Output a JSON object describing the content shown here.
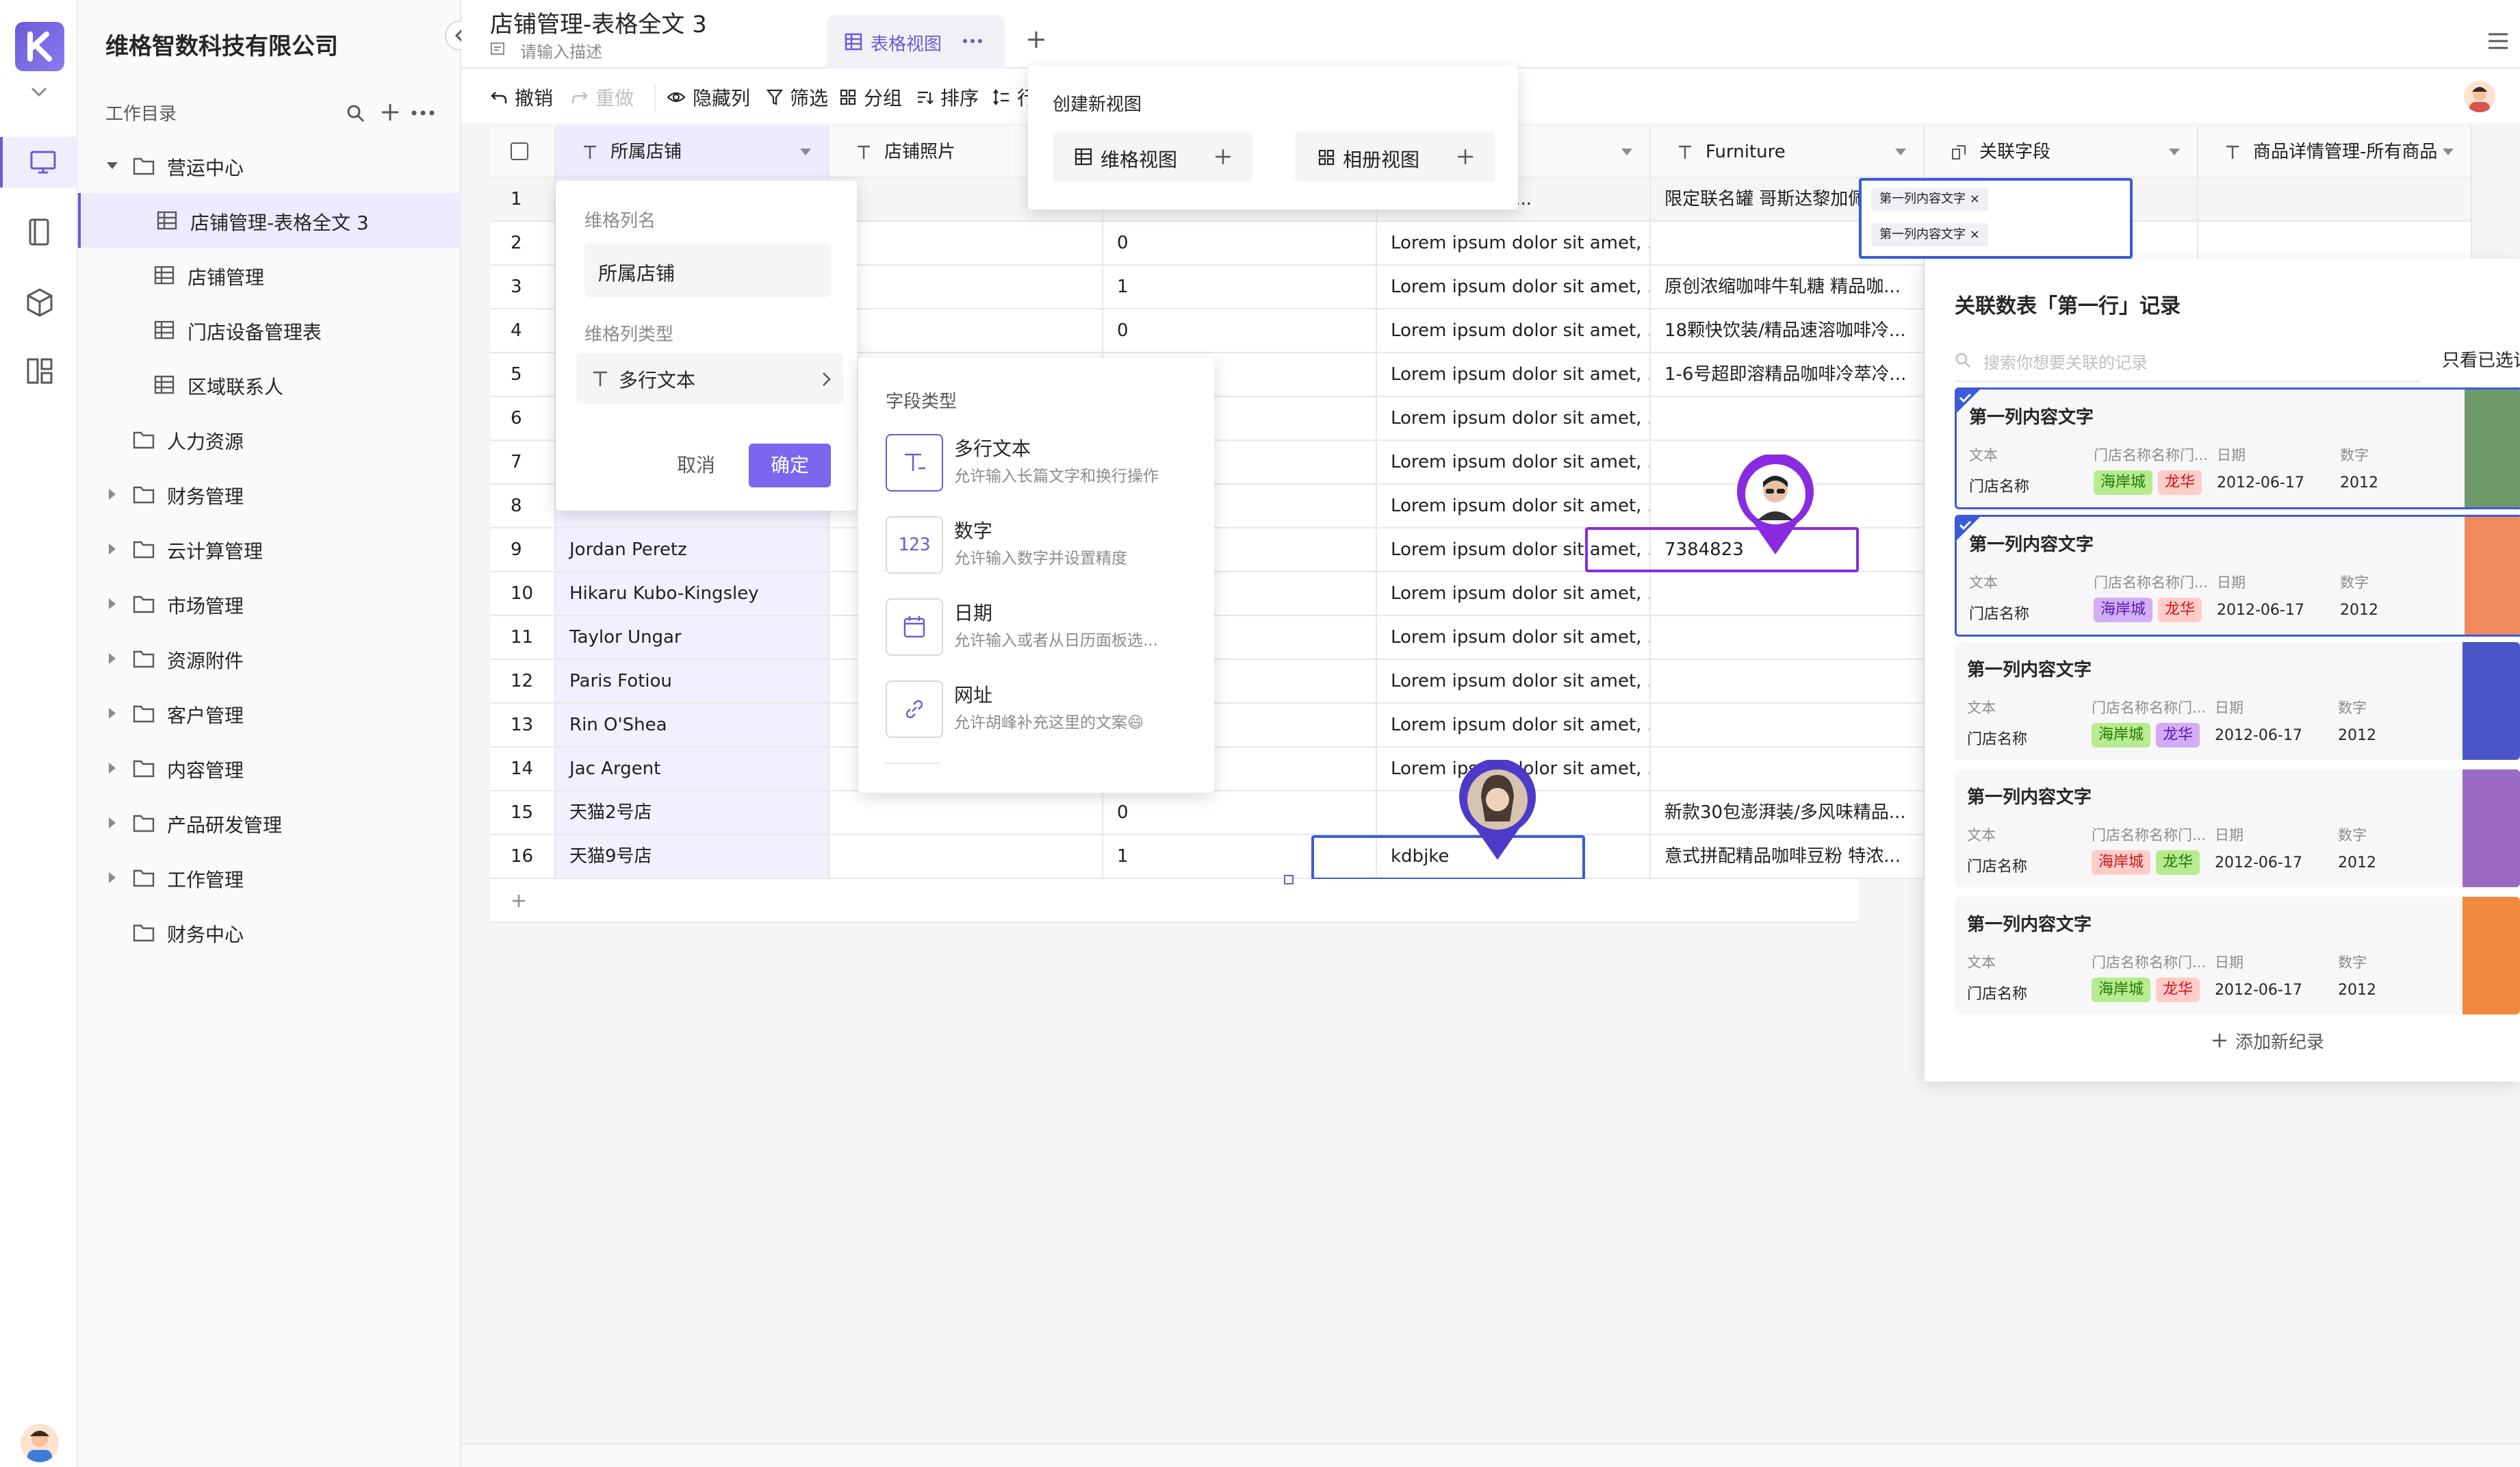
{
  "workspace": {
    "name": "维格智数科技有限公司",
    "catalog_label": "工作目录"
  },
  "tree": [
    {
      "label": "营运中心",
      "kind": "folder",
      "expanded": true,
      "level": 0
    },
    {
      "label": "店铺管理-表格全文 3",
      "kind": "sheet",
      "level": 1,
      "active": true
    },
    {
      "label": "店铺管理",
      "kind": "sheet",
      "level": 1
    },
    {
      "label": "门店设备管理表",
      "kind": "sheet",
      "level": 1
    },
    {
      "label": "区域联系人",
      "kind": "sheet",
      "level": 1
    },
    {
      "label": "人力资源",
      "kind": "folder",
      "level": 0,
      "no_arrow": true
    },
    {
      "label": "财务管理",
      "kind": "folder",
      "level": 0
    },
    {
      "label": "云计算管理",
      "kind": "folder",
      "level": 0
    },
    {
      "label": "市场管理",
      "kind": "folder",
      "level": 0
    },
    {
      "label": "资源附件",
      "kind": "folder",
      "level": 0
    },
    {
      "label": "客户管理",
      "kind": "folder",
      "level": 0
    },
    {
      "label": "内容管理",
      "kind": "folder",
      "level": 0
    },
    {
      "label": "产品研发管理",
      "kind": "folder",
      "level": 0
    },
    {
      "label": "工作管理",
      "kind": "folder",
      "level": 0
    },
    {
      "label": "财务中心",
      "kind": "folder",
      "level": 0,
      "no_arrow": true
    }
  ],
  "sheet": {
    "title": "店铺管理-表格全文 3",
    "desc_placeholder": "请输入描述",
    "tab_label": "表格视图"
  },
  "toolbar": {
    "undo": "撤销",
    "redo": "重做",
    "hide_cols": "隐藏列",
    "filter": "筛选",
    "group": "分组",
    "sort": "排序",
    "more": "行"
  },
  "create_view": {
    "title": "创建新视图",
    "grid_view": "维格视图",
    "gallery_view": "相册视图"
  },
  "columns": [
    "所属店铺",
    "店铺照片",
    "",
    "",
    "Furniture",
    "关联字段",
    "商品详情管理-所有商品"
  ],
  "rows": [
    {
      "n": "1",
      "store": "",
      "num": "",
      "text": "olor sit amet, ...",
      "furniture": "限定联名罐 哥斯达黎加佩拉..."
    },
    {
      "n": "2",
      "store": "",
      "num": "0",
      "text": "Lorem ipsum dolor sit amet, ...",
      "furniture": ""
    },
    {
      "n": "3",
      "store": "",
      "num": "1",
      "text": "Lorem ipsum dolor sit amet, ...",
      "furniture": "原创浓缩咖啡牛轧糖 精品咖..."
    },
    {
      "n": "4",
      "store": "",
      "num": "0",
      "text": "Lorem ipsum dolor sit amet, ...",
      "furniture": "18颗快饮装/精品速溶咖啡冷..."
    },
    {
      "n": "5",
      "store": "",
      "num": "",
      "text": "Lorem ipsum dolor sit amet, ...",
      "furniture": "1-6号超即溶精品咖啡冷萃冷..."
    },
    {
      "n": "6",
      "store": "",
      "num": "",
      "text": "Lorem ipsum dolor sit amet, ...",
      "furniture": ""
    },
    {
      "n": "7",
      "store": "",
      "num": "",
      "text": "Lorem ipsum dolor sit amet, ...",
      "furniture": ""
    },
    {
      "n": "8",
      "store": "",
      "num": "",
      "text": "Lorem ipsum dolor sit amet, ...",
      "furniture": ""
    },
    {
      "n": "9",
      "store": "Jordan Peretz",
      "num": "",
      "text": "Lorem ipsum dolor sit amet, ...",
      "furniture": "7384823"
    },
    {
      "n": "10",
      "store": "Hikaru Kubo-Kingsley",
      "num": "",
      "text": "Lorem ipsum dolor sit amet, ...",
      "furniture": ""
    },
    {
      "n": "11",
      "store": "Taylor Ungar",
      "num": "",
      "text": "Lorem ipsum dolor sit amet, ...",
      "furniture": ""
    },
    {
      "n": "12",
      "store": "Paris Fotiou",
      "num": "",
      "text": "Lorem ipsum dolor sit amet, ...",
      "furniture": ""
    },
    {
      "n": "13",
      "store": "Rin O'Shea",
      "num": "",
      "text": "Lorem ipsum dolor sit amet, ...",
      "furniture": ""
    },
    {
      "n": "14",
      "store": "Jac Argent",
      "num": "",
      "text": "Lorem ipsum dolor sit amet, ...",
      "furniture": ""
    },
    {
      "n": "15",
      "store": "天猫2号店",
      "num": "0",
      "text": "",
      "furniture": "新款30包澎湃装/多风味精品..."
    },
    {
      "n": "16",
      "store": "天猫9号店",
      "num": "1",
      "text": "kdbjke",
      "furniture": "意式拼配精品咖啡豆粉 特浓..."
    }
  ],
  "linked_chip": "第一列内容文字",
  "col_editor": {
    "name_label": "维格列名",
    "name_value": "所属店铺",
    "type_label": "维格列类型",
    "type_value": "多行文本",
    "cancel": "取消",
    "confirm": "确定"
  },
  "field_types": {
    "title": "字段类型",
    "items": [
      {
        "glyph": "T",
        "name": "多行文本",
        "desc": "允许输入长篇文字和换行操作"
      },
      {
        "glyph": "123",
        "name": "数字",
        "desc": "允许输入数字并设置精度"
      },
      {
        "glyph": "cal",
        "name": "日期",
        "desc": "允许输入或者从日历面板选..."
      },
      {
        "glyph": "link",
        "name": "网址",
        "desc": "允许胡峰补充这里的文案😄"
      }
    ]
  },
  "link_panel": {
    "title": "关联数表「第一行」记录",
    "search_placeholder": "搜索你想要关联的记录",
    "only_selected": "只看已选记",
    "add_record": "添加新纪录",
    "card_labels": {
      "text": "文本",
      "store_name_trunc": "门店名称名称门...",
      "date": "日期",
      "number": "数字",
      "store_name": "门店名称"
    },
    "cards": [
      {
        "title": "第一列内容文字",
        "tag1": "海岸城",
        "tag2": "龙华",
        "date": "2012-06-17",
        "number": "2012",
        "checked": true,
        "tag2_color": "#ffccc7",
        "tag2_text": "#cf1322",
        "img_color": "#6e9a6a"
      },
      {
        "title": "第一列内容文字",
        "tag1": "海岸城",
        "tag2": "龙华",
        "date": "2012-06-17",
        "number": "2012",
        "checked": true,
        "tag1_color": "#d3adf7",
        "tag1_text": "#531dab",
        "tag2_color": "#ffccc7",
        "tag2_text": "#cf1322",
        "img_color": "#f08a5d"
      },
      {
        "title": "第一列内容文字",
        "tag1": "海岸城",
        "tag2": "龙华",
        "date": "2012-06-17",
        "number": "2012",
        "checked": false,
        "tag2_color": "#d3adf7",
        "tag2_text": "#531dab",
        "img_color": "#4a55c8"
      },
      {
        "title": "第一列内容文字",
        "tag1": "海岸城",
        "tag2": "龙华",
        "date": "2012-06-17",
        "number": "2012",
        "checked": false,
        "tag1_color": "#ffccc7",
        "tag1_text": "#cf1322",
        "tag2_color": "#b7eb8f",
        "tag2_text": "#237804",
        "img_color": "#9b6bc4"
      },
      {
        "title": "第一列内容文字",
        "tag1": "海岸城",
        "tag2": "龙华",
        "date": "2012-06-17",
        "number": "2012",
        "checked": false,
        "tag2_color": "#ffccc7",
        "tag2_text": "#cf1322",
        "img_color": "#f0883e"
      }
    ]
  },
  "colors": {
    "accent": "#7b67ee",
    "brand": "#6b5bd6",
    "selection": "#3b5bdb",
    "collab_pin": "#8a2be2"
  },
  "icons": [
    "logo-icon",
    "desktop-icon",
    "book-icon",
    "cube-icon",
    "template-icon",
    "search-icon",
    "plus-icon",
    "more-icon",
    "folder-icon",
    "sheet-icon",
    "undo-icon",
    "redo-icon",
    "eye-icon",
    "filter-icon",
    "group-icon",
    "sort-icon",
    "menu-icon",
    "avatar-icon"
  ]
}
